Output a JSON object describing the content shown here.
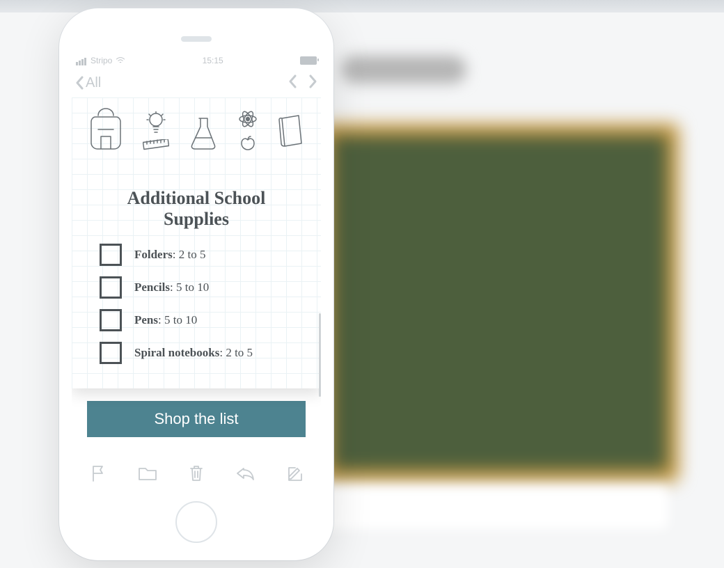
{
  "status": {
    "carrier": "Stripo",
    "time": "15:15"
  },
  "nav": {
    "back_label": "All"
  },
  "email": {
    "heading_line1": "Additional School",
    "heading_line2": "Supplies",
    "items": [
      {
        "name": "Folders",
        "qty": ": 2 to 5"
      },
      {
        "name": "Pencils",
        "qty": ": 5 to 10"
      },
      {
        "name": "Pens",
        "qty": ": 5 to 10"
      },
      {
        "name": "Spiral notebooks",
        "qty": ": 2 to 5"
      }
    ],
    "cta": "Shop the list"
  }
}
